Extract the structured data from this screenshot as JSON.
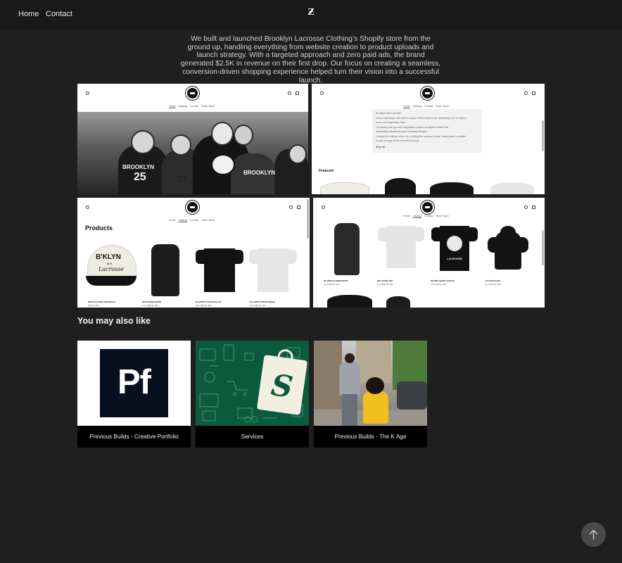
{
  "nav": {
    "home": "Home",
    "contact": "Contact",
    "logo": "Ƶ"
  },
  "intro": "We built and launched Brooklyn Lacrosse Clothing’s Shopify store from the ground up, handling everything from website creation to product uploads and launch strategy. With a targeted approach and zero paid ads, the brand generated $2.5K in revenue on their first drop. Our focus on creating a seamless, conversion-driven shopping experience helped turn their vision into a successful launch.",
  "shots": {
    "nav_items": [
      "Home",
      "Catalog",
      "Contact",
      "Team Store"
    ],
    "hero_jersey": [
      "BROOKLYN",
      "25",
      "13",
      "BROOKLYN"
    ],
    "s2_lines": [
      "Brooklyn and Lacrosse",
      "Only's a Brooklyn, the other's a sport. Both cultures are undeniably rich in history,",
      "icons, and legendary style.",
      "Combining that grit and imagination comes an apparel brand that",
      "seamlessly blends into your everyday lifestyle.",
      "Created for chilling in the Lot, or hitting the workout circuit. Every piece is crafted",
      "to pay homage to the innovators to you.",
      "Shop all →"
    ],
    "featured": "Featured",
    "products_title": "Products",
    "cap_text": [
      "B'KLYN",
      "N.Y.",
      "Lacrosse"
    ],
    "s3_products": [
      {
        "name": "BKLYN CLASSIC SNAPBACK",
        "price": "$40.00 USD"
      },
      {
        "name": "BKLYN SWEATPANT",
        "price": "From $60.00 USD"
      },
      {
        "name": "B1 SHORT SLEEVE BLACK",
        "price": "From $38.00 USD"
      },
      {
        "name": "B1 SHORT SLEEVE WHITE",
        "price": "From $38.00 USD"
      }
    ],
    "s4_products": [
      {
        "name": "B1 VINTAGE SWEATPANT",
        "price": "From $65.00 USD"
      },
      {
        "name": "BKY STARS TEE",
        "price": "From $38.00 USD"
      },
      {
        "name": "HELMET SHORT SLEEVE",
        "price": "From $38.00 USD"
      },
      {
        "name": "LAX MAN HOOD",
        "price": "From $60.00 USD"
      }
    ],
    "s4_tee_text": "LACROSSE"
  },
  "also_like": {
    "title": "You may also like",
    "cards": [
      {
        "label": "Previous Builds - Creative Portfolio",
        "art": "Pf"
      },
      {
        "label": "Services",
        "art": "S"
      },
      {
        "label": "Previous Builds - The K Age"
      }
    ]
  },
  "colors": {
    "bg": "#1f1f1f",
    "topbar": "#191919",
    "portfolio_navy": "#06101f",
    "services_green": "#0c5a3e"
  },
  "icons": {
    "scroll_top": "arrow-up-icon"
  }
}
